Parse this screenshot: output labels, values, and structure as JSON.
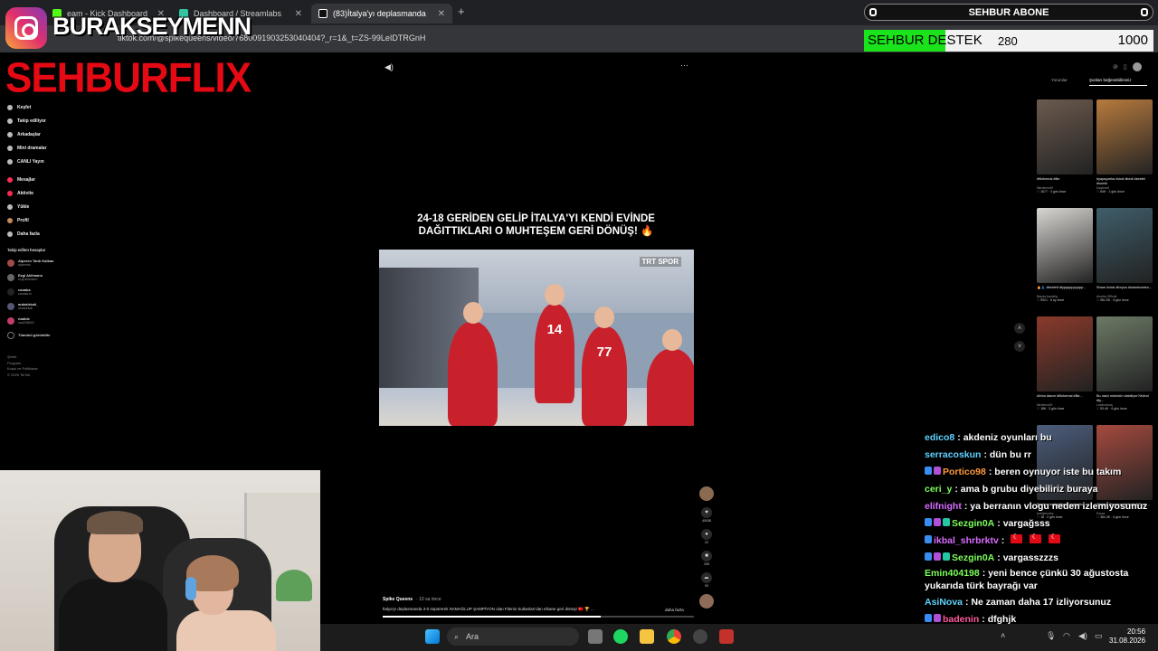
{
  "browser": {
    "tabs": [
      {
        "title": "eam - Kick Dashboard"
      },
      {
        "title": "Dashboard / Streamlabs"
      },
      {
        "title": "(83)İtalya'yı deplasmanda 3"
      }
    ],
    "url": "tiktok.com/@spikequeens/video/7680091903253040404?_r=1&_t=ZS-99LeIDTRGnH"
  },
  "overlay": {
    "instagram_handle": "BURAKSEYMENN",
    "abone_label": "SEHBUR ABONE",
    "destek_label": "SEHBUR DESTEK",
    "destek_current": "280",
    "destek_goal": "1000",
    "destek_progress": 0.28,
    "logo": "SEHBURFLIX"
  },
  "sidebar": {
    "items": [
      {
        "label": "Keşfet",
        "icon": "compass-icon"
      },
      {
        "label": "Takip ediliyor",
        "icon": "following-icon"
      },
      {
        "label": "Arkadaşlar",
        "icon": "friends-icon"
      },
      {
        "label": "Mini dramalar",
        "icon": "drama-icon"
      },
      {
        "label": "CANLI Yayın",
        "icon": "live-icon"
      },
      {
        "label": "Mesajlar",
        "icon": "message-icon"
      },
      {
        "label": "Aktivite",
        "icon": "activity-icon"
      },
      {
        "label": "Yükle",
        "icon": "upload-icon"
      },
      {
        "label": "Profil",
        "icon": "profile-icon"
      },
      {
        "label": "Daha fazla",
        "icon": "more-icon"
      }
    ],
    "following_header": "Takip edilen hesaplar",
    "accounts": [
      {
        "name": "Alperen Tarık Kalkan",
        "handle": "alperenb"
      },
      {
        "name": "Ezgi Akllmann",
        "handle": "ezgi.aklimann"
      },
      {
        "name": "caoaka",
        "handle": "caoaka.tv"
      },
      {
        "name": "ardakirkali_",
        "handle": "ardakirkali"
      },
      {
        "name": "nadide",
        "handle": "nad298453"
      }
    ],
    "show_all": "Tümünü görüntüle",
    "footer": [
      "Şirket",
      "Program",
      "Koşul ve Politikalar",
      "© 2026 TikTok"
    ]
  },
  "video": {
    "headline": "24-18 GERİDEN GELİP İTALYA'YI KENDİ EVİNDE DAĞITTIKLARI O MUHTEŞEM GERİ DÖNÜŞ! 🔥",
    "broadcaster": "TRT SPOR",
    "jersey_numbers": [
      "14",
      "77"
    ],
    "author": "Spike Queens",
    "time_ago": "· 10 sa önce",
    "description": "İtalya'yı deplasmanda 3-0 süpürerek NAMAĞLUP ŞAMPİYON olan Filenin Sultanları'dan efsane geri dönüş! 🇹🇷 🏆 ...",
    "more": "daha fazla",
    "progress": 0.7,
    "actions": [
      {
        "icon": "heart-icon",
        "count": "40038"
      },
      {
        "icon": "comment-icon",
        "count": "22"
      },
      {
        "icon": "bookmark-icon",
        "count": "208"
      },
      {
        "icon": "share-icon",
        "count": "93"
      }
    ]
  },
  "right_panel": {
    "tabs": [
      "Yorumlar",
      "Şunları beğenebilirsiniz"
    ],
    "cards": [
      {
        "caption": "#fikrkemal #fikr",
        "author": "fikirdemo09",
        "stats": "♡ 1677 · 3 gün önce",
        "color": "#6b5a4e"
      },
      {
        "caption": "#yapayzeka #viral #kedi #kesfet #komik",
        "author": "Dayborel",
        "stats": "♡ 64K · 2 gün önce",
        "color": "#b77a3d"
      },
      {
        "caption": "🔥👗 #kesfett #fypppppppppp...",
        "author": "Bayda karaköy",
        "stats": "♡ 9921 · 8 ay önce",
        "color": "#d9d6d2"
      },
      {
        "caption": "Share #viral #foryou #islamicvideo...",
        "author": "Amelia Official",
        "stats": "♡ 981.5K · 6 gün önce",
        "color": "#3f5e6a"
      },
      {
        "caption": "Africa dance #fikrkemal #fikr...",
        "author": "fikrdemo09",
        "stats": "♡ 186 · 3 gün önce",
        "color": "#8a3a2b"
      },
      {
        "caption": "Bu nasıl mümkün olabiliyor?!#viral #fy...",
        "author": "Lewbodnaş",
        "stats": "♡ 53.4K · 6 gün önce",
        "color": "#6c7a66"
      },
      {
        "caption": "Şunlara başladığını hayal edin...",
        "author": "turkiyevoley",
        "stats": "♡ 18 · 2 gün önce",
        "color": "#4c5d7c"
      },
      {
        "caption": "Türkiye Womens Volleyball Team...",
        "author": "Esraa",
        "stats": "♡ 384.3K · 6 gün önce",
        "color": "#a54a3e"
      }
    ]
  },
  "chat": [
    {
      "user": "edico8",
      "color": "#5fd3ff",
      "text": "akdeniz oyunları bu",
      "badges": []
    },
    {
      "user": "serracoskun",
      "color": "#5fd3ff",
      "text": "dün bu rr",
      "badges": []
    },
    {
      "user": "Portico98",
      "color": "#ff9a3c",
      "text": "beren oynuyor iste bu takım",
      "badges": [
        "#3a8df0",
        "#b04fd8"
      ]
    },
    {
      "user": "ceri_y",
      "color": "#7dff5a",
      "text": "ama b grubu diyebiliriz buraya",
      "badges": []
    },
    {
      "user": "elifnight",
      "color": "#d86bff",
      "text": "ya berranın vlogu neden izlemiyosunuz",
      "badges": []
    },
    {
      "user": "Sezgin0A",
      "color": "#7dff5a",
      "text": "vargağsss",
      "badges": [
        "#3a8df0",
        "#b04fd8",
        "#22c8a0"
      ]
    },
    {
      "user": "ikbal_shrbrktv",
      "color": "#d86bff",
      "text": "",
      "badges": [
        "#3a8df0"
      ],
      "flags": 3
    },
    {
      "user": "Sezgin0A",
      "color": "#7dff5a",
      "text": "vargasszzzs",
      "badges": [
        "#3a8df0",
        "#b04fd8",
        "#22c8a0"
      ]
    },
    {
      "user": "Emin404198",
      "color": "#7dff5a",
      "text": "yeni bence çünkü 30 ağustosta yukarıda türk bayrağı var",
      "badges": [],
      "two": true
    },
    {
      "user": "AsiNova",
      "color": "#5fd3ff",
      "text": "Ne zaman daha 17 izliyorsunuz",
      "badges": []
    },
    {
      "user": "badenin",
      "color": "#ff5a9e",
      "text": "dfghjk",
      "badges": [
        "#3a8df0",
        "#b04fd8"
      ]
    },
    {
      "user": "Sezgin0A",
      "color": "#7dff5a",
      "text": "",
      "badges": [
        "#3a8df0",
        "#b04fd8",
        "#22c8a0"
      ]
    }
  ],
  "taskbar": {
    "search_label": "Ara",
    "time": "20:56",
    "date": "31.08.2026"
  }
}
